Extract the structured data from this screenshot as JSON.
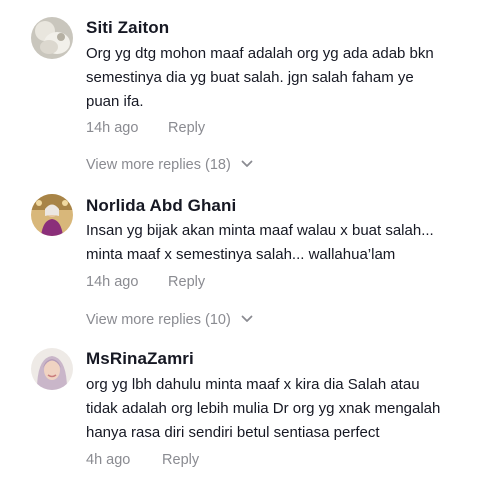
{
  "comments": [
    {
      "author": "Siti Zaiton",
      "avatar_icon": "avatar-icon",
      "lines": [
        "Org yg dtg mohon maaf adalah org yg ada adab bkn",
        "semestinya dia yg buat salah. jgn salah faham ye",
        "puan ifa."
      ],
      "time": "14h ago",
      "reply_label": "Reply",
      "view_more": "View more replies (18)"
    },
    {
      "author": "Norlida Abd Ghani",
      "avatar_icon": "avatar-icon",
      "lines": [
        "Insan yg bijak akan minta maaf walau x buat salah...",
        "minta maaf x semestinya salah... wallahua’lam"
      ],
      "time": "14h ago",
      "reply_label": "Reply",
      "view_more": "View more replies (10)"
    },
    {
      "author": "MsRinaZamri",
      "avatar_icon": "avatar-icon",
      "lines": [
        "org yg lbh dahulu minta maaf x kira dia Salah atau",
        "tidak adalah org lebih mulia Dr org yg xnak mengalah",
        "hanya rasa diri sendiri betul sentiasa perfect"
      ],
      "time": "4h ago",
      "reply_label": "Reply"
    }
  ],
  "colors": {
    "text_primary": "#161823",
    "text_secondary": "#8a8b91",
    "background": "#ffffff"
  },
  "icons": {
    "chevron": "chevron-down-icon"
  }
}
